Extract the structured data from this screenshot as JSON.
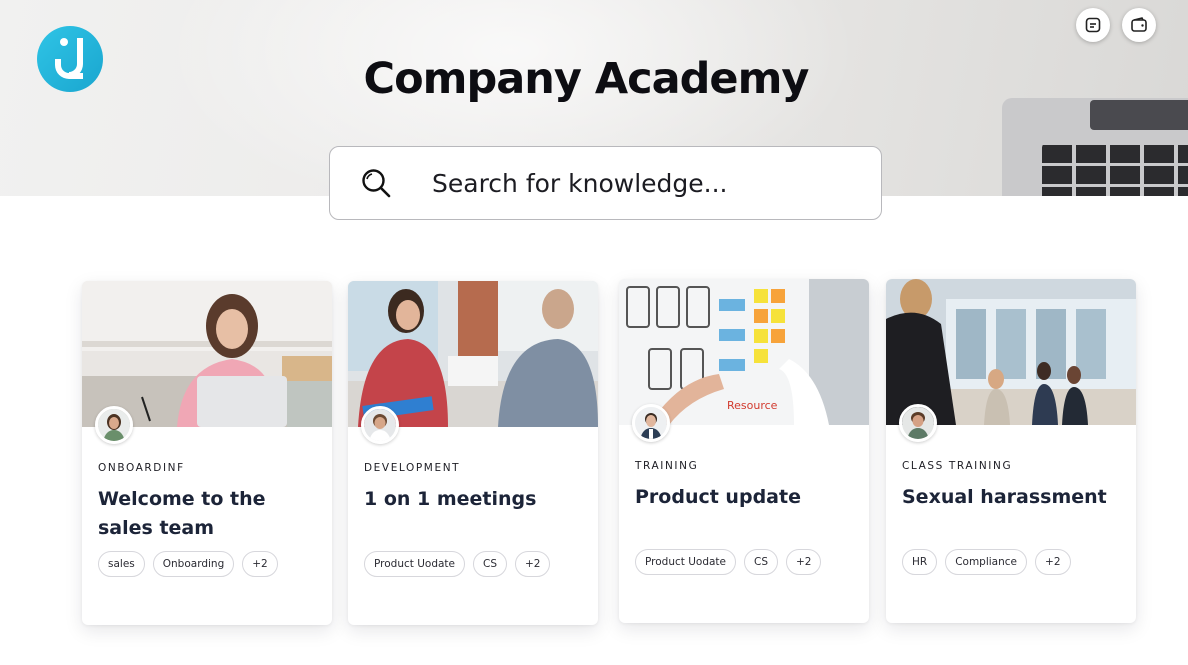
{
  "header": {
    "title": "Company Academy",
    "search_placeholder": "Search for knowledge..."
  },
  "cards": [
    {
      "category": "ONBOARDINF",
      "title": "Welcome to the sales team",
      "tags": [
        "sales",
        "Onboarding",
        "+2"
      ]
    },
    {
      "category": "DEVELOPMENT",
      "title": "1 on 1 meetings",
      "tags": [
        "Product Uodate",
        "CS",
        "+2"
      ]
    },
    {
      "category": "TRAINING",
      "title": "Product update",
      "tags": [
        "Product Uodate",
        "CS",
        "+2"
      ]
    },
    {
      "category": "CLASS TRAINING",
      "title": "Sexual harassment",
      "tags": [
        "HR",
        "Compliance",
        "+2"
      ]
    }
  ],
  "colors": {
    "brand": "#1fb2d9",
    "title": "#0d0d12",
    "card_title": "#1c2438"
  }
}
